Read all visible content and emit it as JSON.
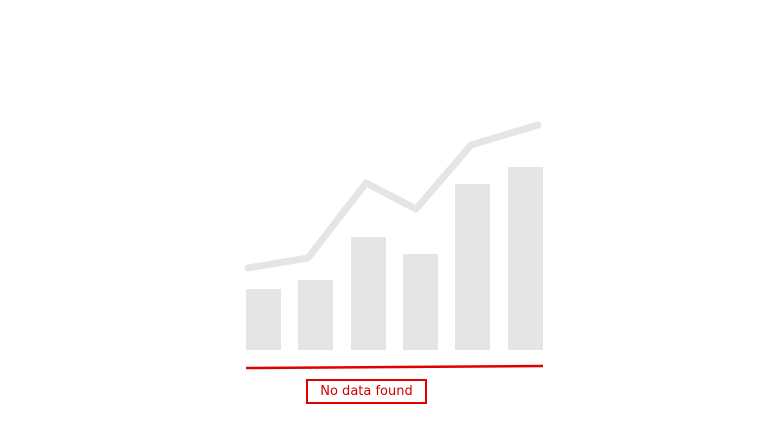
{
  "empty_state": {
    "message": "No data found",
    "illustration_icon": "bar-line-chart-placeholder-icon"
  },
  "colors": {
    "placeholder_gray": "#e5e5e5",
    "highlight_red": "#e00000"
  }
}
